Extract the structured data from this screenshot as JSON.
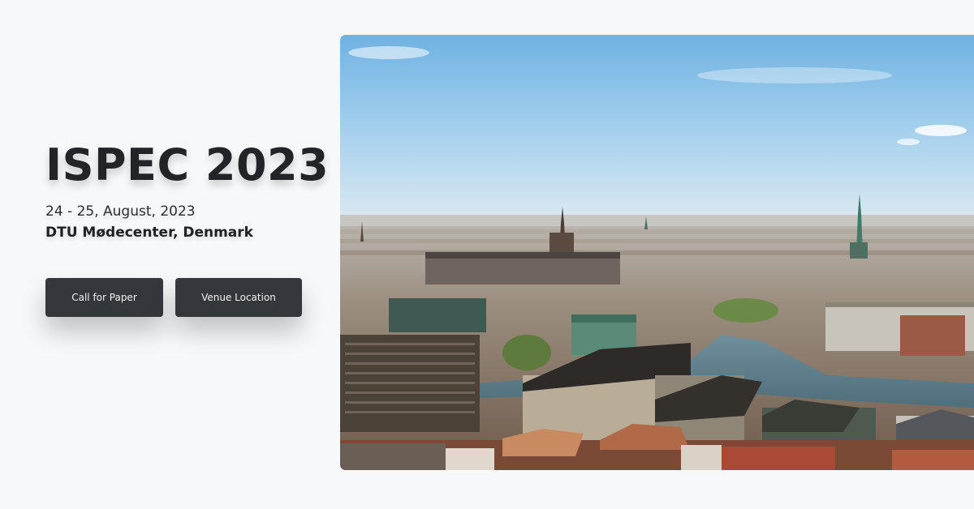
{
  "hero": {
    "title": "ISPEC 2023",
    "dates": "24 - 25, August, 2023",
    "venue": "DTU Mødecenter, Denmark"
  },
  "buttons": {
    "call_for_paper": "Call for Paper",
    "venue_location": "Venue Location"
  },
  "colors": {
    "background": "#f7f8fa",
    "button": "#34373b",
    "title": "#222427"
  }
}
